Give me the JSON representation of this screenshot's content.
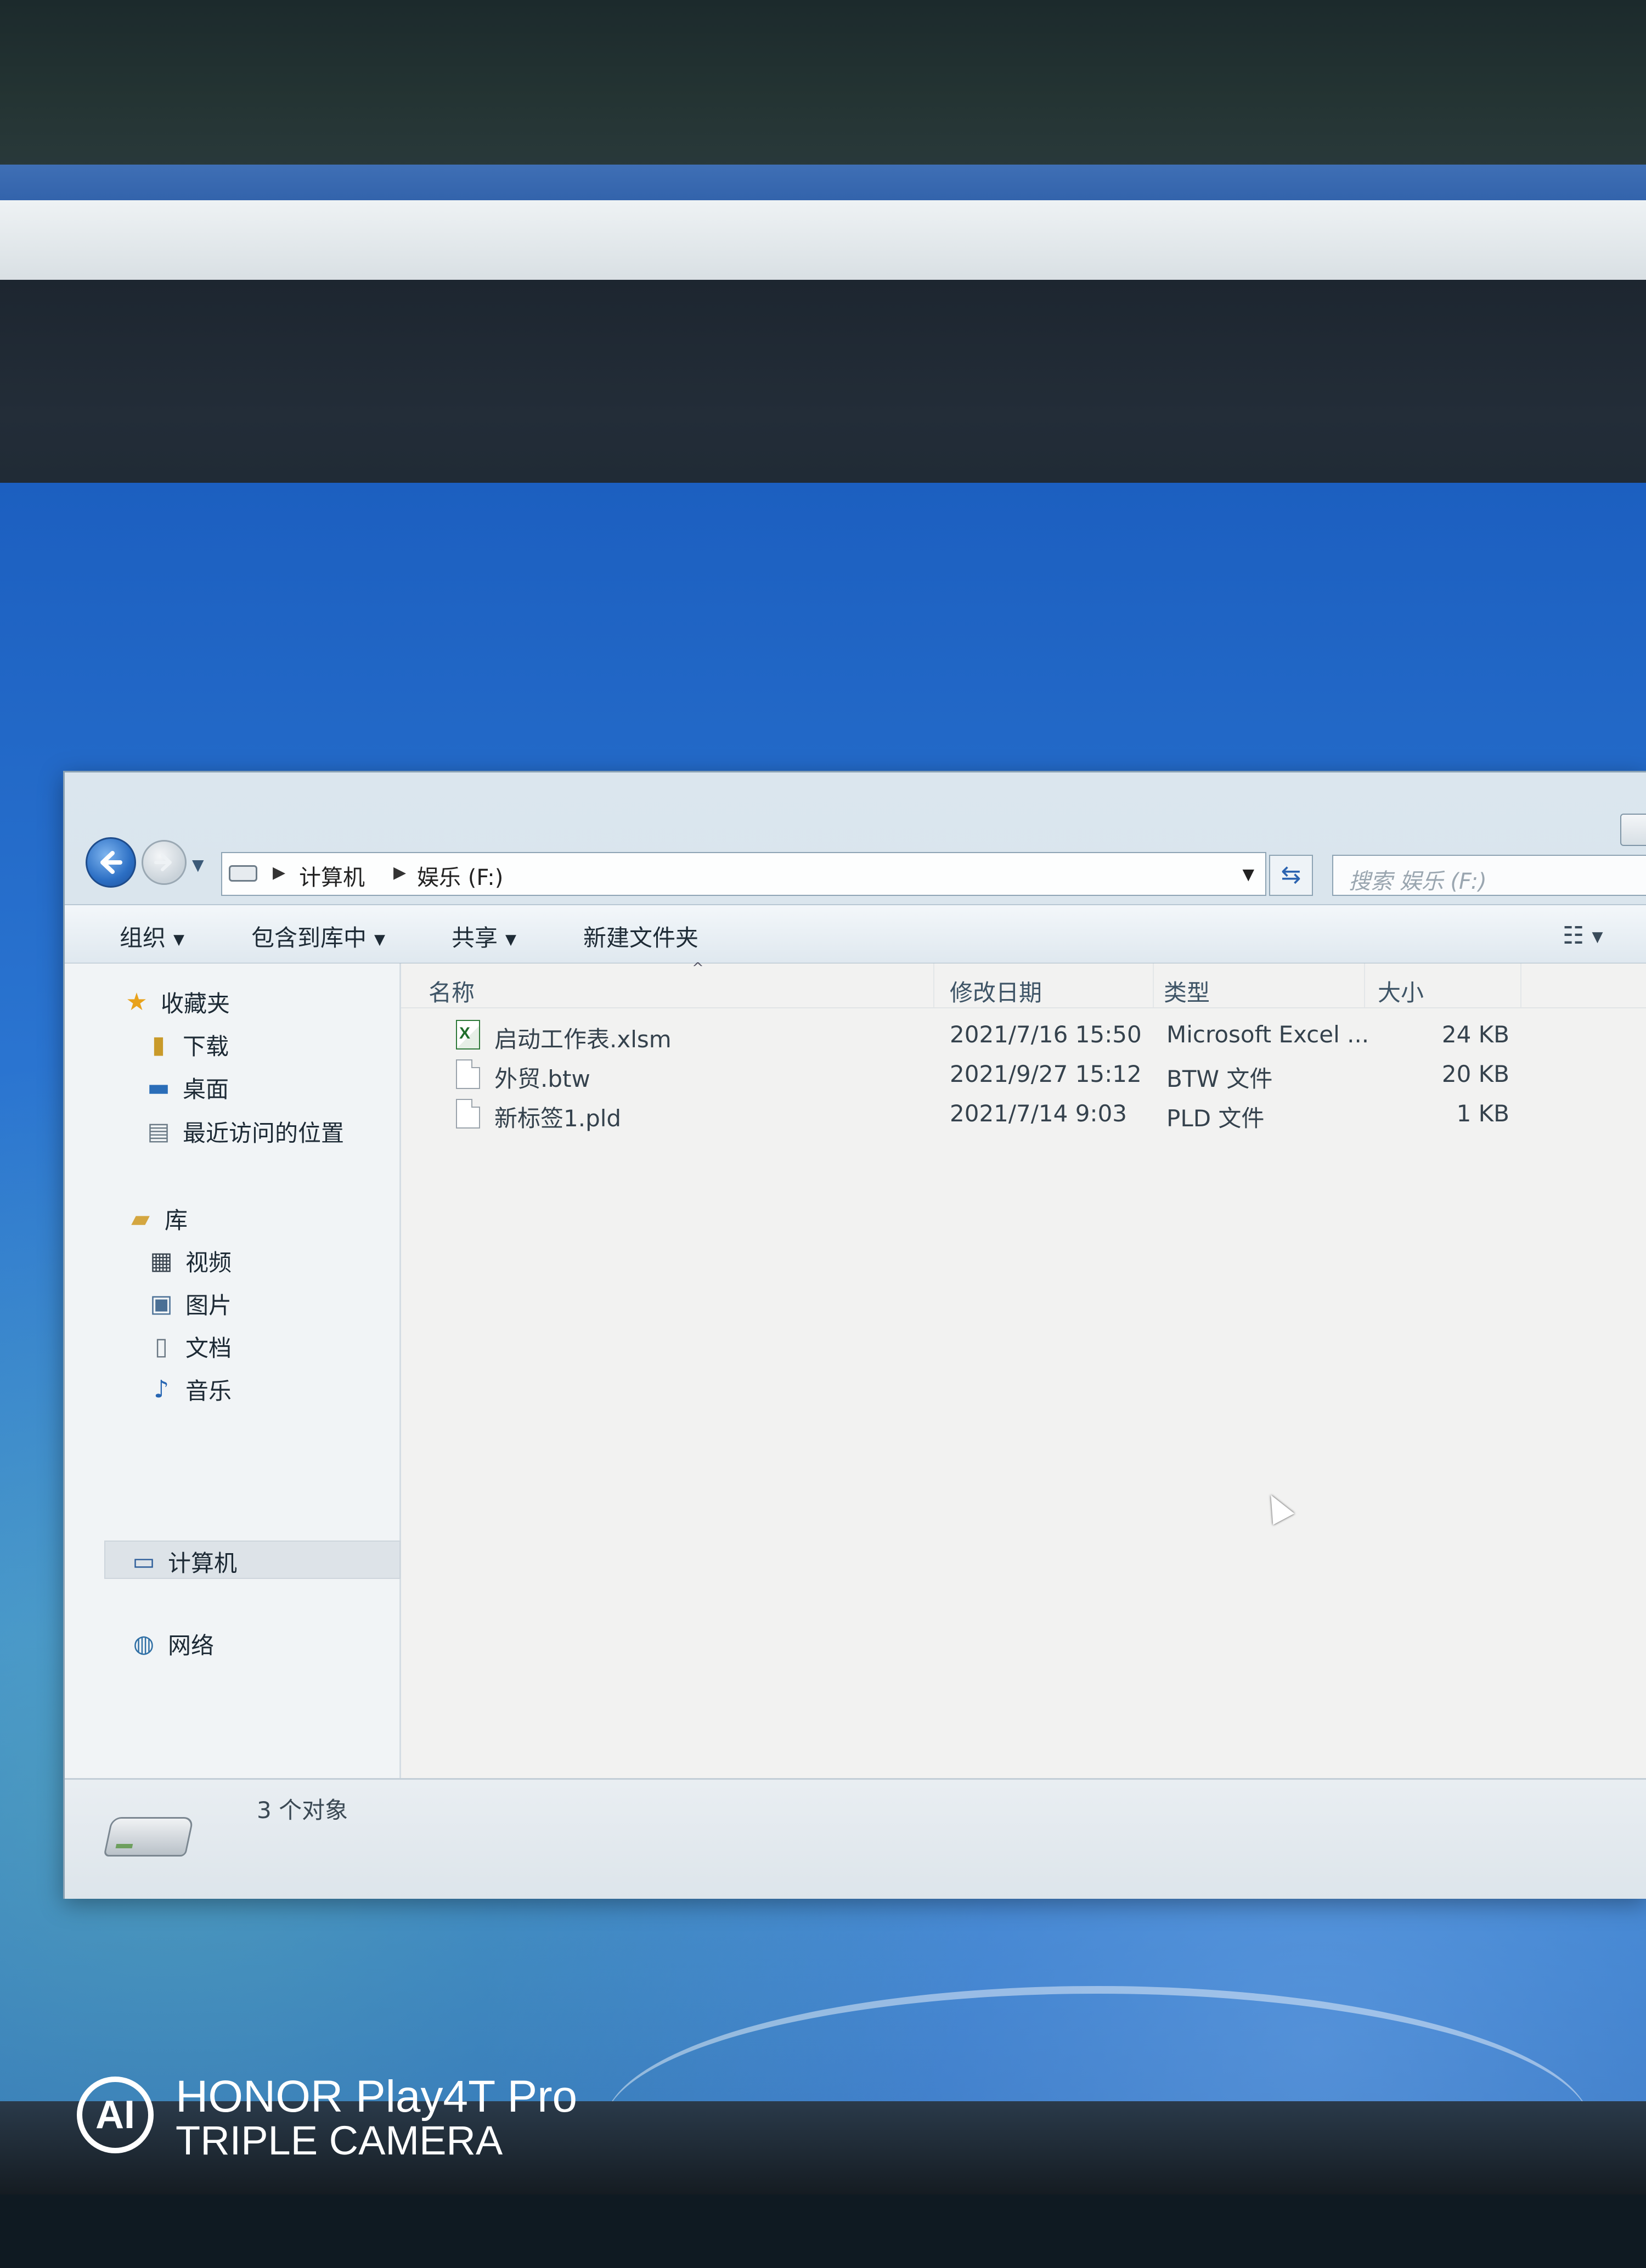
{
  "address": {
    "segments": [
      "计算机",
      "娱乐 (F:)"
    ]
  },
  "search": {
    "placeholder": "搜索 娱乐 (F:)"
  },
  "toolbar": {
    "organize": "组织",
    "include_in_library": "包含到库中",
    "share": "共享",
    "new_folder": "新建文件夹"
  },
  "nav": {
    "favorites": "收藏夹",
    "downloads": "下载",
    "desktop": "桌面",
    "recent": "最近访问的位置",
    "libraries": "库",
    "videos": "视频",
    "pictures": "图片",
    "documents": "文档",
    "music": "音乐",
    "computer": "计算机",
    "network": "网络"
  },
  "columns": {
    "name": "名称",
    "date": "修改日期",
    "type": "类型",
    "size": "大小"
  },
  "files": [
    {
      "name": "启动工作表.xlsm",
      "date": "2021/7/16 15:50",
      "type": "Microsoft Excel ...",
      "size": "24 KB",
      "icon": "excel-file-icon"
    },
    {
      "name": "外贸.btw",
      "date": "2021/9/27 15:12",
      "type": "BTW 文件",
      "size": "20 KB",
      "icon": "generic-file-icon"
    },
    {
      "name": "新标签1.pld",
      "date": "2021/7/14 9:03",
      "type": "PLD 文件",
      "size": "1 KB",
      "icon": "generic-file-icon"
    }
  ],
  "status": {
    "count": "3 个对象"
  },
  "watermark": {
    "logo": "AI",
    "line1": "HONOR Play4T Pro",
    "line2": "TRIPLE CAMERA"
  }
}
